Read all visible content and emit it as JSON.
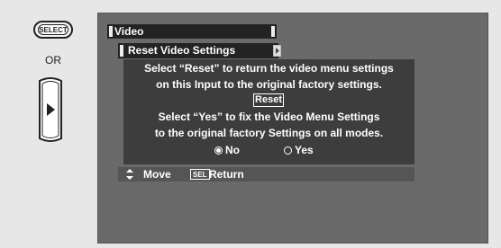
{
  "remote": {
    "select_button_label": "SELECT",
    "or_label": "OR",
    "dpad_icon": "dpad-right-arrow-icon"
  },
  "menu": {
    "title": "Video",
    "submenu_title": "Reset Video Settings",
    "message": {
      "line1": "Select “Reset” to return the video menu settings",
      "line2": "on this Input to the original factory settings.",
      "reset_button": "Reset",
      "line3": "Select “Yes” to fix the Video Menu Settings",
      "line4": "to the original factory Settings on all modes."
    },
    "options": [
      {
        "label": "No",
        "selected": true
      },
      {
        "label": "Yes",
        "selected": false
      }
    ],
    "nav": {
      "move_label": "Move",
      "sel_badge": "SEL",
      "return_label": "Return"
    }
  },
  "colors": {
    "background": "#e7e7e7",
    "screen": "#6a6a6a",
    "bar": "#232323",
    "message_box": "#3d3d3d",
    "nav_bar": "#555555"
  }
}
